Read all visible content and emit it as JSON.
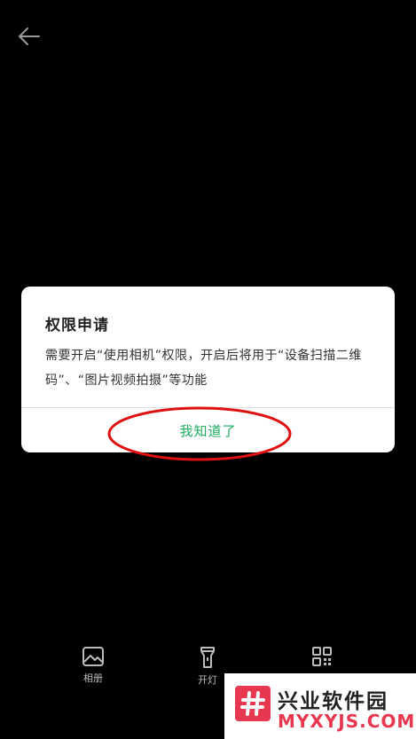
{
  "header": {
    "back_icon": "arrow-left-icon"
  },
  "dialog": {
    "title": "权限申请",
    "message": "需要开启“使用相机”权限，开启后将用于“设备扫描二维码”、“图片视频拍摄”等功能",
    "button_label": "我知道了",
    "button_color": "#1aad60"
  },
  "annotation": {
    "color": "#e01010"
  },
  "toolbar": {
    "items": [
      {
        "label": "相册",
        "icon": "image-icon"
      },
      {
        "label": "开灯",
        "icon": "flashlight-icon"
      },
      {
        "label": "",
        "icon": "qrcode-icon"
      }
    ]
  },
  "watermark": {
    "title": "兴业软件园",
    "domain": "MYXYJS.COM",
    "brand_color": "#e8384f"
  }
}
